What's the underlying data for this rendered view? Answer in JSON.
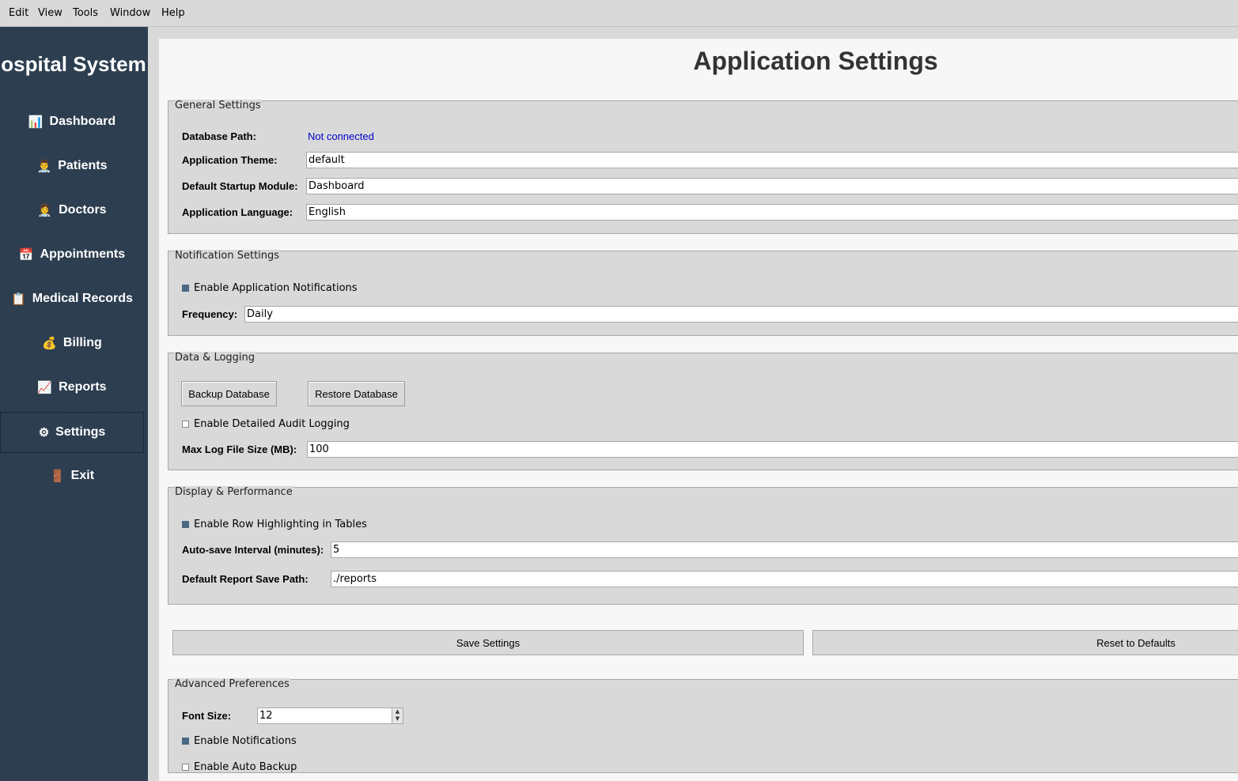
{
  "menubar": {
    "items": [
      "Edit",
      "View",
      "Tools",
      "Window",
      "Help"
    ]
  },
  "sidebar": {
    "title": "ospital System",
    "items": [
      {
        "icon": "📊",
        "label": "Dashboard"
      },
      {
        "icon": "👨‍⚕️",
        "label": "Patients"
      },
      {
        "icon": "👩‍⚕️",
        "label": "Doctors"
      },
      {
        "icon": "📅",
        "label": "Appointments"
      },
      {
        "icon": "📋",
        "label": "Medical Records"
      },
      {
        "icon": "💰",
        "label": "Billing"
      },
      {
        "icon": "📈",
        "label": "Reports"
      },
      {
        "icon": "⚙",
        "label": "Settings"
      },
      {
        "icon": "🚪",
        "label": "Exit"
      }
    ],
    "active_item": "Settings"
  },
  "main": {
    "title": "Application Settings",
    "general": {
      "legend": "General Settings",
      "db_path_label": "Database Path:",
      "db_path_value": "Not connected",
      "db_path_color": "#0000cc",
      "theme_label": "Application Theme:",
      "theme_value": "default",
      "startup_label": "Default Startup Module:",
      "startup_value": "Dashboard",
      "language_label": "Application Language:",
      "language_value": "English"
    },
    "notification": {
      "legend": "Notification Settings",
      "enable_label": "Enable Application Notifications",
      "enable_checked": true,
      "frequency_label": "Frequency:",
      "frequency_value": "Daily"
    },
    "data_logging": {
      "legend": "Data & Logging",
      "backup_label": "Backup Database",
      "restore_label": "Restore Database",
      "audit_label": "Enable Detailed Audit Logging",
      "audit_checked": false,
      "max_log_label": "Max Log File Size (MB):",
      "max_log_value": "100"
    },
    "display": {
      "legend": "Display & Performance",
      "row_highlight_label": "Enable Row Highlighting in Tables",
      "row_highlight_checked": true,
      "autosave_label": "Auto-save Interval (minutes):",
      "autosave_value": "5",
      "report_path_label": "Default Report Save Path:",
      "report_path_value": "./reports"
    },
    "actions": {
      "save_label": "Save Settings",
      "reset_label": "Reset to Defaults"
    },
    "advanced": {
      "legend": "Advanced Preferences",
      "font_size_label": "Font Size:",
      "font_size_value": "12",
      "notifications_label": "Enable Notifications",
      "notifications_checked": true,
      "auto_backup_label": "Enable Auto Backup",
      "auto_backup_checked": false
    }
  },
  "colors": {
    "sidebar_bg": "#2c3e50",
    "check_accent": "#4a6984",
    "window_bg": "#d9d9d9"
  }
}
